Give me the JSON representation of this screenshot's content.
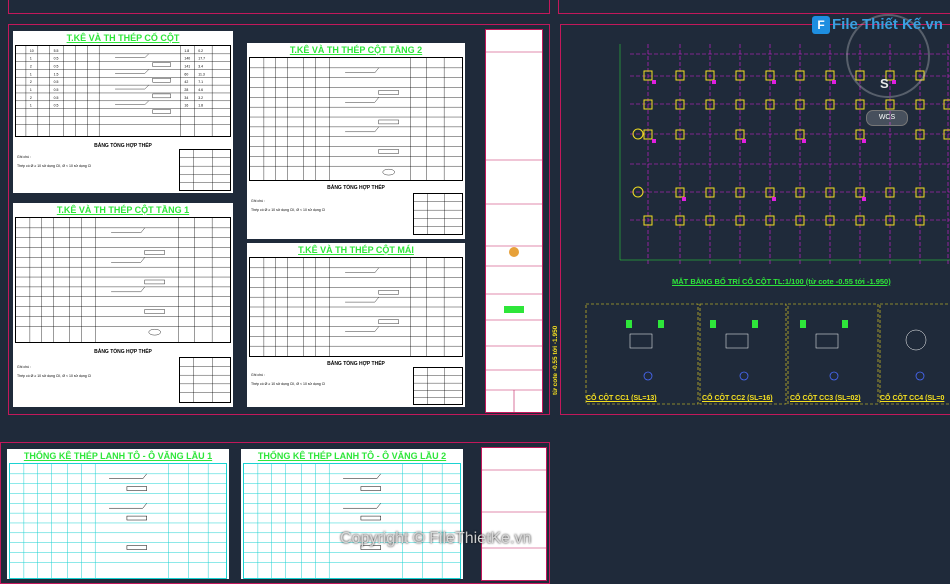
{
  "tables": {
    "tl_title": "T.KÊ VÀ TH THÉP CỔ CỘT",
    "tr_title": "T.KÊ VÀ TH THÉP CỘT TẦNG 2",
    "bl_title": "T.KÊ VÀ TH THÉP CỘT TẦNG 1",
    "br_title": "T.KÊ VÀ TH THÉP CỘT MÁI",
    "summary": "BẢNG TỔNG HỢP THÉP",
    "note_label": "Ghi chú :",
    "note_text": "Thép có Ø ≥ 10 sử dụng CII, Ø < 10 sử dụng CI",
    "lintel1_title": "THỐNG KÊ THÉP LANH TÔ - Ô VĂNG LẦU 1",
    "lintel2_title": "THỐNG KÊ THÉP LANH TÔ - Ô VĂNG LẦU 2"
  },
  "plan": {
    "caption": "MẶT BẰNG BỐ TRÍ CỔ CỘT  TL:1/100 (từ cote -0.55 tới -1.950)",
    "side_label": "từ cote -0.55 tới -1.950",
    "details": [
      "CỔ CỘT CC1 (SL=13)",
      "CỔ CỘT CC2 (SL=16)",
      "CỔ CỘT CC3 (SL=02)",
      "CỔ CỘT CC4 (SL=0"
    ]
  },
  "ui": {
    "compass_letter": "S",
    "wcs_label": "WCS",
    "logo_text": "File Thiết Kế.vn",
    "watermark": "Copyright © FileThietKe.vn"
  },
  "colors": {
    "background": "#1f2a3a",
    "sheet_border": "#c2185b",
    "title_green": "#2ee63a",
    "grid_magenta": "#e020e0",
    "column_yellow": "#f5e020"
  }
}
